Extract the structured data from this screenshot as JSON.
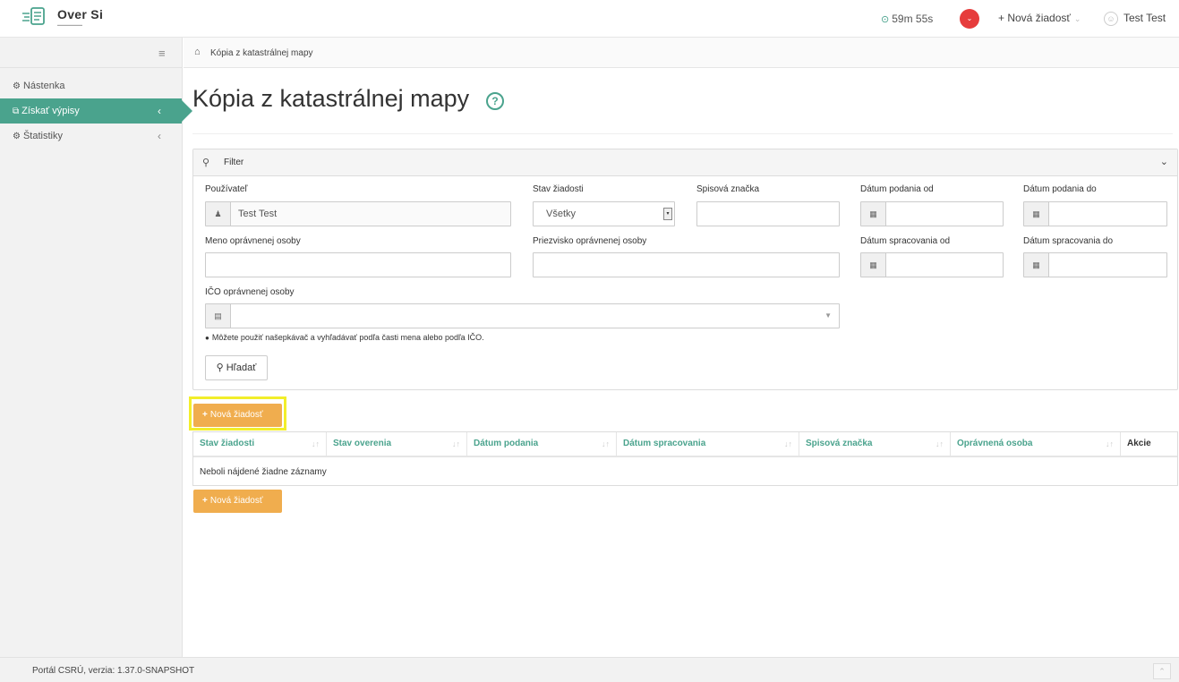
{
  "header": {
    "logo_title": "Over Si",
    "timer": "59m 55s",
    "new_request": "+ Nová žiadosť",
    "user": "Test Test"
  },
  "sidebar": {
    "items": [
      {
        "label": "Nástenka",
        "active": false
      },
      {
        "label": "Získať výpisy",
        "active": true
      },
      {
        "label": "Štatistiky",
        "active": false
      }
    ]
  },
  "breadcrumb": {
    "current": "Kópia z katastrálnej mapy"
  },
  "page": {
    "title": "Kópia z katastrálnej mapy"
  },
  "filter": {
    "title": "Filter",
    "user_label": "Používateľ",
    "user_value": "Test Test",
    "state_label": "Stav žiadosti",
    "state_value": "Všetky",
    "file_no_label": "Spisová značka",
    "file_no_value": "",
    "submitted_from_label": "Dátum podania od",
    "submitted_to_label": "Dátum podania do",
    "person_name_label": "Meno oprávnenej osoby",
    "person_surname_label": "Priezvisko oprávnenej osoby",
    "processed_from_label": "Dátum spracovania od",
    "processed_to_label": "Dátum spracovania do",
    "ico_label": "IČO oprávnenej osoby",
    "hint": "Môžete použiť našepkávač a vyhľadávať podľa časti mena alebo podľa IČO.",
    "search_button": "Hľadať"
  },
  "actions": {
    "new_request": "Nová žiadosť"
  },
  "table": {
    "columns": [
      "Stav žiadosti",
      "Stav overenia",
      "Dátum podania",
      "Dátum spracovania",
      "Spisová značka",
      "Oprávnená osoba",
      "Akcie"
    ],
    "empty_message": "Neboli nájdené žiadne záznamy"
  },
  "footer": {
    "text": "Portál CSRÚ, verzia: 1.37.0-SNAPSHOT"
  },
  "colors": {
    "accent": "#4aa38d",
    "warning": "#f0ad4e",
    "alert": "#e63c3c",
    "highlight": "#f2ee2a"
  }
}
